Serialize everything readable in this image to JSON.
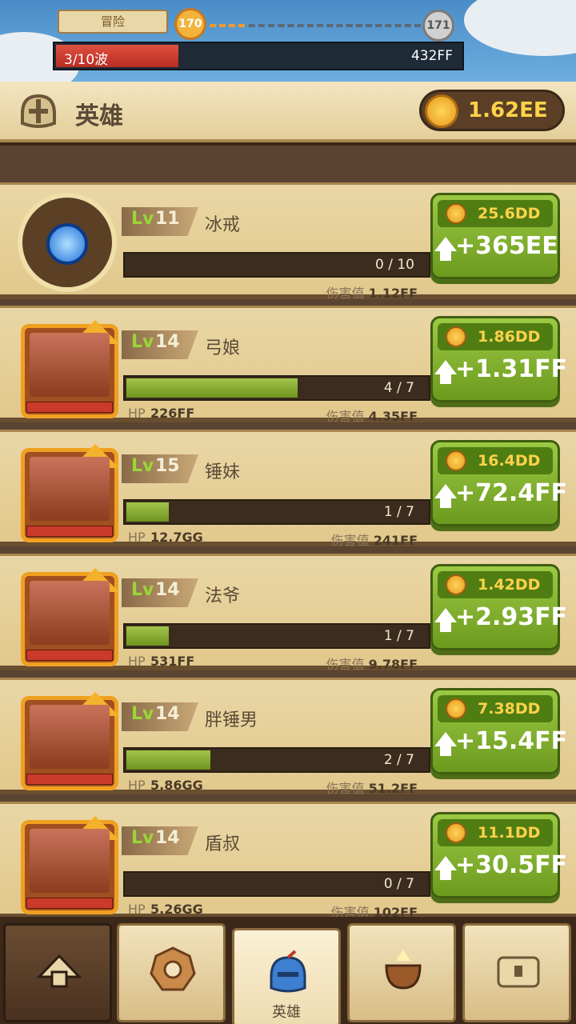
{
  "top_bar": {
    "mode_label": "冒险",
    "current_stage": "170",
    "next_stage": "171",
    "wave_label": "3/10波",
    "wave_progress": 0.3,
    "boss_hp": "432FF"
  },
  "header": {
    "title": "英雄",
    "gold": "1.62EE"
  },
  "cards": [
    {
      "lv_label": "Lv",
      "level": "11",
      "name": "冰戒",
      "progress_text": "0 / 10",
      "progress": 0.0,
      "hp_label": "",
      "hp": "",
      "dmg_label": "伤害值",
      "dmg": "1.12FF",
      "cost": "25.6DD",
      "gain": "+365EE",
      "kind": "item"
    },
    {
      "lv_label": "Lv",
      "level": "14",
      "name": "弓娘",
      "progress_text": "4 / 7",
      "progress": 0.57,
      "hp_label": "HP",
      "hp": "226FF",
      "dmg_label": "伤害值",
      "dmg": "4.35FF",
      "cost": "1.86DD",
      "gain": "+1.31FF",
      "kind": "hero"
    },
    {
      "lv_label": "Lv",
      "level": "15",
      "name": "锤妹",
      "progress_text": "1 / 7",
      "progress": 0.14,
      "hp_label": "HP",
      "hp": "12.7GG",
      "dmg_label": "伤害值",
      "dmg": "241FF",
      "cost": "16.4DD",
      "gain": "+72.4FF",
      "kind": "hero"
    },
    {
      "lv_label": "Lv",
      "level": "14",
      "name": "法爷",
      "progress_text": "1 / 7",
      "progress": 0.14,
      "hp_label": "HP",
      "hp": "531FF",
      "dmg_label": "伤害值",
      "dmg": "9.78FF",
      "cost": "1.42DD",
      "gain": "+2.93FF",
      "kind": "hero"
    },
    {
      "lv_label": "Lv",
      "level": "14",
      "name": "胖锤男",
      "progress_text": "2 / 7",
      "progress": 0.28,
      "hp_label": "HP",
      "hp": "5.86GG",
      "dmg_label": "伤害值",
      "dmg": "51.2FF",
      "cost": "7.38DD",
      "gain": "+15.4FF",
      "kind": "hero"
    },
    {
      "lv_label": "Lv",
      "level": "14",
      "name": "盾叔",
      "progress_text": "0 / 7",
      "progress": 0.0,
      "hp_label": "HP",
      "hp": "5.26GG",
      "dmg_label": "伤害值",
      "dmg": "102FF",
      "cost": "11.1DD",
      "gain": "+30.5FF",
      "kind": "hero"
    }
  ],
  "nav": {
    "active_label": "英雄",
    "tabs": [
      "camp-icon",
      "gear-icon",
      "helmet-icon",
      "cauldron-icon",
      "treasure-chest-icon"
    ]
  },
  "colors": {
    "accent_gold": "#ffd24a",
    "upgrade_green": "#8cbb34",
    "wave_red": "#cc3a2c",
    "level_green": "#9ad637"
  }
}
